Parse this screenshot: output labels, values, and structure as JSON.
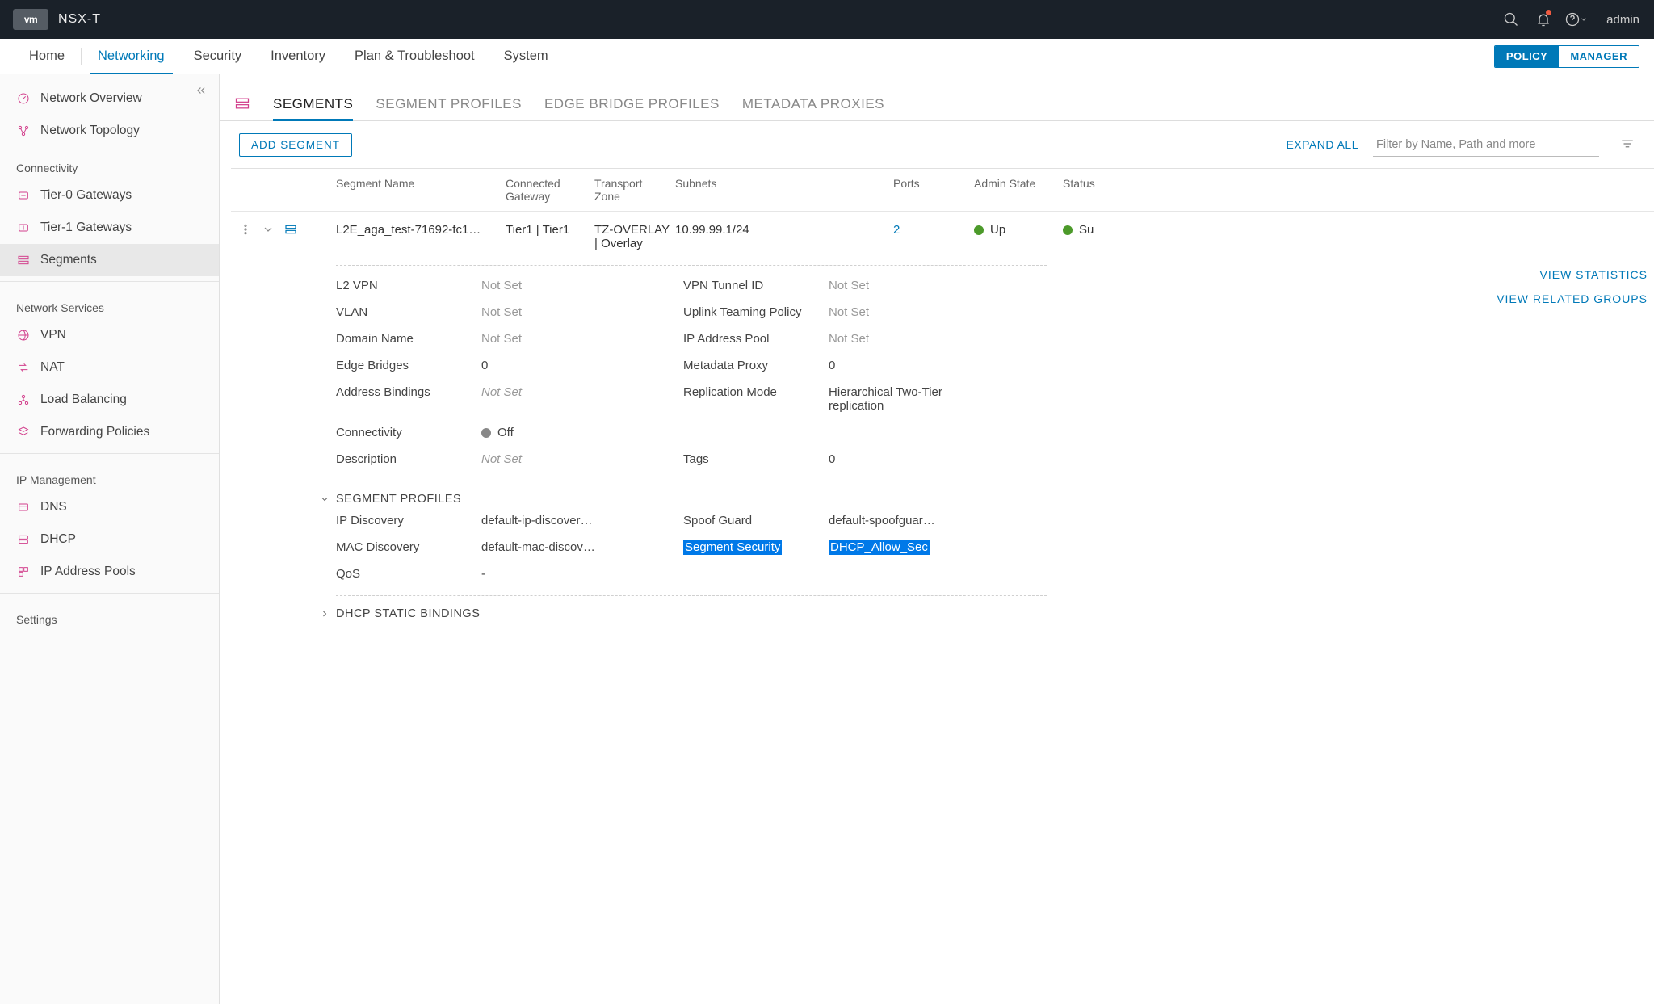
{
  "topbar": {
    "logo": "vm",
    "product": "NSX-T",
    "user": "admin"
  },
  "nav": {
    "items": [
      "Home",
      "Networking",
      "Security",
      "Inventory",
      "Plan & Troubleshoot",
      "System"
    ],
    "active_index": 1,
    "toggle": {
      "policy": "POLICY",
      "manager": "MANAGER",
      "active": "policy"
    }
  },
  "sidebar": {
    "top": [
      {
        "label": "Network Overview",
        "icon": "gauge-icon"
      },
      {
        "label": "Network Topology",
        "icon": "topology-icon"
      }
    ],
    "groups": [
      {
        "title": "Connectivity",
        "items": [
          {
            "label": "Tier-0 Gateways",
            "icon": "t0-icon"
          },
          {
            "label": "Tier-1 Gateways",
            "icon": "t1-icon"
          },
          {
            "label": "Segments",
            "icon": "segments-icon",
            "active": true
          }
        ]
      },
      {
        "title": "Network Services",
        "items": [
          {
            "label": "VPN",
            "icon": "vpn-icon"
          },
          {
            "label": "NAT",
            "icon": "nat-icon"
          },
          {
            "label": "Load Balancing",
            "icon": "lb-icon"
          },
          {
            "label": "Forwarding Policies",
            "icon": "fw-icon"
          }
        ]
      },
      {
        "title": "IP Management",
        "items": [
          {
            "label": "DNS",
            "icon": "dns-icon"
          },
          {
            "label": "DHCP",
            "icon": "dhcp-icon"
          },
          {
            "label": "IP Address Pools",
            "icon": "ippool-icon"
          }
        ]
      },
      {
        "title": "Settings",
        "items": []
      }
    ]
  },
  "tabs": {
    "items": [
      "SEGMENTS",
      "SEGMENT PROFILES",
      "EDGE BRIDGE PROFILES",
      "METADATA PROXIES"
    ],
    "active_index": 0
  },
  "actions": {
    "add": "ADD SEGMENT",
    "expand": "EXPAND ALL",
    "filter_placeholder": "Filter by Name, Path and more"
  },
  "columns": [
    "Segment Name",
    "Connected Gateway",
    "Transport Zone",
    "Subnets",
    "Ports",
    "Admin State",
    "Status"
  ],
  "row": {
    "name": "L2E_aga_test-71692-fc1…",
    "gateway": "Tier1 | Tier1",
    "tz": "TZ-OVERLAY | Overlay",
    "subnets": "10.99.99.1/24",
    "ports": "2",
    "admin_state": "Up",
    "status": "Su"
  },
  "detail": {
    "l2vpn": {
      "label": "L2 VPN",
      "value": "Not Set"
    },
    "vpntunnel": {
      "label": "VPN Tunnel ID",
      "value": "Not Set"
    },
    "vlan": {
      "label": "VLAN",
      "value": "Not Set"
    },
    "uplink": {
      "label": "Uplink Teaming Policy",
      "value": "Not Set"
    },
    "domain": {
      "label": "Domain Name",
      "value": "Not Set"
    },
    "ippool": {
      "label": "IP Address Pool",
      "value": "Not Set"
    },
    "edgebr": {
      "label": "Edge Bridges",
      "value": "0"
    },
    "mdproxy": {
      "label": "Metadata Proxy",
      "value": "0"
    },
    "addrbind": {
      "label": "Address Bindings",
      "value": "Not Set"
    },
    "repl": {
      "label": "Replication Mode",
      "value": "Hierarchical Two-Tier replication"
    },
    "conn": {
      "label": "Connectivity",
      "value": "Off"
    },
    "desc": {
      "label": "Description",
      "value": "Not Set"
    },
    "tags": {
      "label": "Tags",
      "value": "0"
    }
  },
  "sidelinks": {
    "stats": "VIEW STATISTICS",
    "groups": "VIEW RELATED GROUPS"
  },
  "sections": {
    "profiles_header": "SEGMENT PROFILES",
    "profiles": {
      "ip": {
        "label": "IP Discovery",
        "value": "default-ip-discover…"
      },
      "spoof": {
        "label": "Spoof Guard",
        "value": "default-spoofguar…"
      },
      "mac": {
        "label": "MAC Discovery",
        "value": "default-mac-discov…"
      },
      "sec": {
        "label": "Segment Security",
        "value": "DHCP_Allow_Sec"
      },
      "qos": {
        "label": "QoS",
        "value": "-"
      }
    },
    "dhcp_header": "DHCP STATIC BINDINGS"
  }
}
